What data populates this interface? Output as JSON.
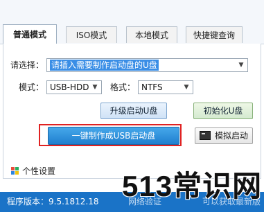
{
  "tabs": [
    {
      "label": "普通模式",
      "active": true
    },
    {
      "label": "ISO模式",
      "active": false
    },
    {
      "label": "本地模式",
      "active": false
    },
    {
      "label": "快捷键查询",
      "active": false
    }
  ],
  "device": {
    "label": "请选择：",
    "value": "请插入需要制作启动盘的U盘"
  },
  "mode": {
    "label": "模式：",
    "value": "USB-HDD"
  },
  "format": {
    "label": "格式：",
    "value": "NTFS"
  },
  "buttons": {
    "upgrade": "升级启动U盘",
    "init": "初始化U盘",
    "make": "一键制作成USB启动盘",
    "simulate": "模拟启动"
  },
  "settings": {
    "label": "个性设置"
  },
  "footer": {
    "version": "程序版本：9.5.1812.18",
    "faint_left": "网络验证",
    "faint_right": "可以获取最新版"
  },
  "watermark": "513常识网",
  "icons": {
    "simulate": "monitor-icon",
    "settings": "grid-icon",
    "dropdown": "chevron-down-icon"
  },
  "colors": {
    "primary_button": "#2b8fdf",
    "footer": "#1a73c7",
    "highlight_frame": "#e02222"
  }
}
